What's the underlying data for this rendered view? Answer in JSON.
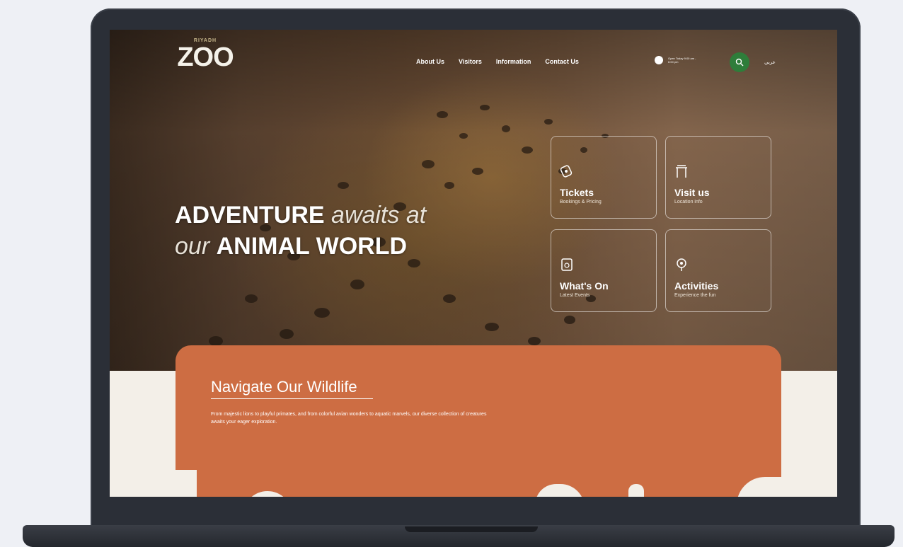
{
  "header": {
    "logo_small": "RIYADH",
    "logo_main": "ZOO",
    "nav": [
      "About Us",
      "Visitors",
      "Information",
      "Contact Us"
    ],
    "hours_text": "Open Today 9:00 am - 6:00 pm",
    "language": "عربي"
  },
  "hero": {
    "headline_bold_1": "ADVENTURE",
    "headline_italic_1": "awaits at",
    "headline_italic_2": "our",
    "headline_bold_2": "ANIMAL WORLD"
  },
  "cards": [
    {
      "icon": "ticket-icon",
      "title": "Tickets",
      "subtitle": "Bookings & Pricing"
    },
    {
      "icon": "gate-icon",
      "title": "Visit us",
      "subtitle": "Location info"
    },
    {
      "icon": "calendar-icon",
      "title": "What's On",
      "subtitle": "Latest Events"
    },
    {
      "icon": "activity-icon",
      "title": "Activities",
      "subtitle": "Experience the fun"
    }
  ],
  "wildlife": {
    "title": "Navigate Our Wildlife",
    "description": "From majestic lions to playful primates, and from colorful avian wonders to aquatic marvels, our diverse collection of creatures awaits your eager exploration."
  },
  "colors": {
    "accent_orange": "#cd6d43",
    "search_green": "#2e7d3a",
    "laptop_frame": "#2b2f37"
  }
}
